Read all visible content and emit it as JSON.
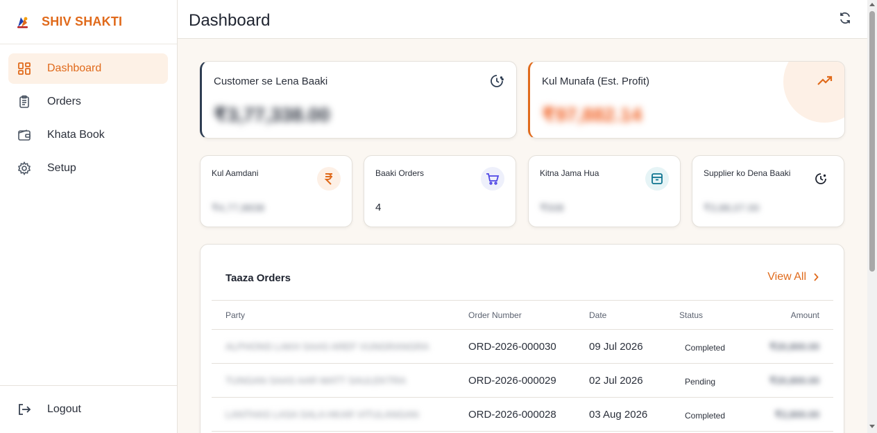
{
  "brand": {
    "name": "SHIV SHAKTI"
  },
  "sidebar": {
    "items": [
      {
        "label": "Dashboard",
        "icon": "dashboard-grid-icon",
        "active": true
      },
      {
        "label": "Orders",
        "icon": "clipboard-icon",
        "active": false
      },
      {
        "label": "Khata Book",
        "icon": "wallet-icon",
        "active": false
      },
      {
        "label": "Setup",
        "icon": "gear-icon",
        "active": false
      }
    ],
    "logout_label": "Logout"
  },
  "header": {
    "title": "Dashboard",
    "refresh_icon": "refresh-icon"
  },
  "summary": {
    "receivable": {
      "label": "Customer se Lena Baaki",
      "value": "₹3,77,338.00",
      "icon": "clock-icon"
    },
    "profit": {
      "label": "Kul Munafa (Est. Profit)",
      "value": "₹97,882.14",
      "icon": "trending-up-icon"
    }
  },
  "stats": [
    {
      "label": "Kul Aamdani",
      "value": "₹4,77,8838",
      "icon": "rupee-icon",
      "icon_color": "#e06a1b",
      "icon_bg": "#fdf0e6"
    },
    {
      "label": "Baaki Orders",
      "value": "4",
      "icon": "cart-icon",
      "icon_color": "#4f46e5",
      "icon_bg": "#eef0fb"
    },
    {
      "label": "Kitna Jama Hua",
      "value": "₹508",
      "icon": "archive-box-icon",
      "icon_color": "#0e7490",
      "icon_bg": "#e6f4f6"
    },
    {
      "label": "Supplier ko Dena Baaki",
      "value": "₹3,88,07.00",
      "icon": "clock-icon",
      "icon_color": "#1f2430",
      "icon_bg": "#ffffff"
    }
  ],
  "orders": {
    "title": "Taaza Orders",
    "view_all": "View All",
    "columns": [
      "Party",
      "Order Number",
      "Date",
      "Status",
      "Amount"
    ],
    "rows": [
      {
        "party": "ALPHONS LAKH SAAS AREF VUNGRANGRA",
        "order_number": "ORD-2026-000030",
        "date": "09 Jul 2026",
        "status": "Completed",
        "amount": "₹20,800.00"
      },
      {
        "party": "TUNGAN SAAS AAR MATT SAULEKTRA",
        "order_number": "ORD-2026-000029",
        "date": "02 Jul 2026",
        "status": "Pending",
        "amount": "₹20,800.00"
      },
      {
        "party": "LANTHAS LASA SALA HKAR VITULANGAN",
        "order_number": "ORD-2026-000028",
        "date": "03 Aug 2026",
        "status": "Completed",
        "amount": "₹2,800.00"
      }
    ]
  },
  "colors": {
    "accent": "#e06a1b",
    "dark_accent": "#2e3d52",
    "background": "#fbf7f2"
  }
}
